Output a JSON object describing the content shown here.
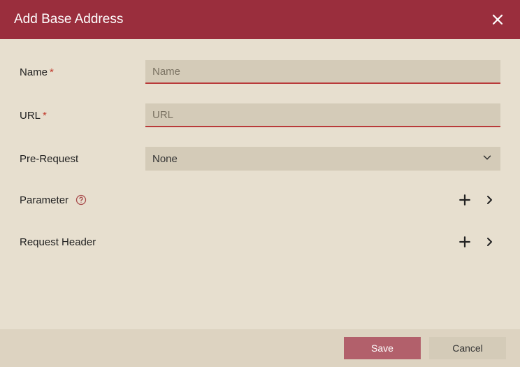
{
  "header": {
    "title": "Add Base Address"
  },
  "fields": {
    "name": {
      "label": "Name",
      "placeholder": "Name",
      "value": ""
    },
    "url": {
      "label": "URL",
      "placeholder": "URL",
      "value": ""
    },
    "preRequest": {
      "label": "Pre-Request",
      "selected": "None"
    }
  },
  "sections": {
    "parameter": {
      "label": "Parameter"
    },
    "requestHeader": {
      "label": "Request Header"
    }
  },
  "footer": {
    "save": "Save",
    "cancel": "Cancel"
  },
  "colors": {
    "accent": "#9a2e3d",
    "inputBg": "#d4cbb8",
    "inputBorder": "#b93a3a",
    "pageBg": "#e7dfcf"
  }
}
